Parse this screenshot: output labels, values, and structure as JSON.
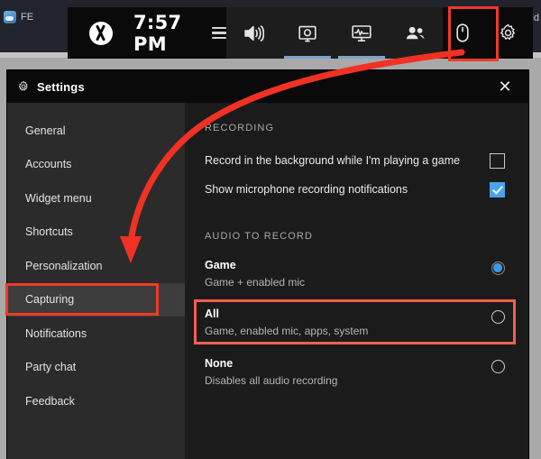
{
  "background": {
    "left_tab_label": "FE",
    "left_tab_icon": "cloud-icon",
    "right_tab_label": "Add",
    "right_tab_icon": "wordpress-icon"
  },
  "game_bar": {
    "logo_icon": "xbox-logo-icon",
    "time": "7:57 PM",
    "menu_icon": "hamburger-menu-icon",
    "icons": [
      {
        "name": "audio-icon",
        "label": "Audio",
        "active": false
      },
      {
        "name": "capture-icon",
        "label": "Capture",
        "active": true
      },
      {
        "name": "performance-icon",
        "label": "Performance",
        "active": true
      },
      {
        "name": "xbox-social-icon",
        "label": "Xbox Social",
        "active": false
      },
      {
        "name": "resources-icon",
        "label": "Resources",
        "active": false
      },
      {
        "name": "settings-gear-icon",
        "label": "Settings",
        "active": false
      }
    ]
  },
  "settings": {
    "title": "Settings",
    "title_icon": "gear-icon",
    "close_label": "✕",
    "sidebar": {
      "items": [
        {
          "label": "General",
          "selected": false
        },
        {
          "label": "Accounts",
          "selected": false
        },
        {
          "label": "Widget menu",
          "selected": false
        },
        {
          "label": "Shortcuts",
          "selected": false
        },
        {
          "label": "Personalization",
          "selected": false
        },
        {
          "label": "Capturing",
          "selected": true
        },
        {
          "label": "Notifications",
          "selected": false
        },
        {
          "label": "Party chat",
          "selected": false
        },
        {
          "label": "Feedback",
          "selected": false
        }
      ]
    },
    "content": {
      "recording": {
        "section_label": "RECORDING",
        "options": [
          {
            "label": "Record in the background while I'm playing a game",
            "checked": false
          },
          {
            "label": "Show microphone recording notifications",
            "checked": true
          }
        ]
      },
      "audio_to_record": {
        "section_label": "AUDIO TO RECORD",
        "options": [
          {
            "title": "Game",
            "subtitle": "Game + enabled mic",
            "selected": true
          },
          {
            "title": "All",
            "subtitle": "Game, enabled mic, apps, system",
            "selected": false
          },
          {
            "title": "None",
            "subtitle": "Disables all audio recording",
            "selected": false
          }
        ]
      }
    }
  },
  "annotations": {
    "highlight_color": "#f03a25",
    "arrow_color": "#f03124",
    "highlighted_elements": [
      "settings-gear-icon",
      "sidebar-item-capturing",
      "audio-option-all"
    ]
  }
}
